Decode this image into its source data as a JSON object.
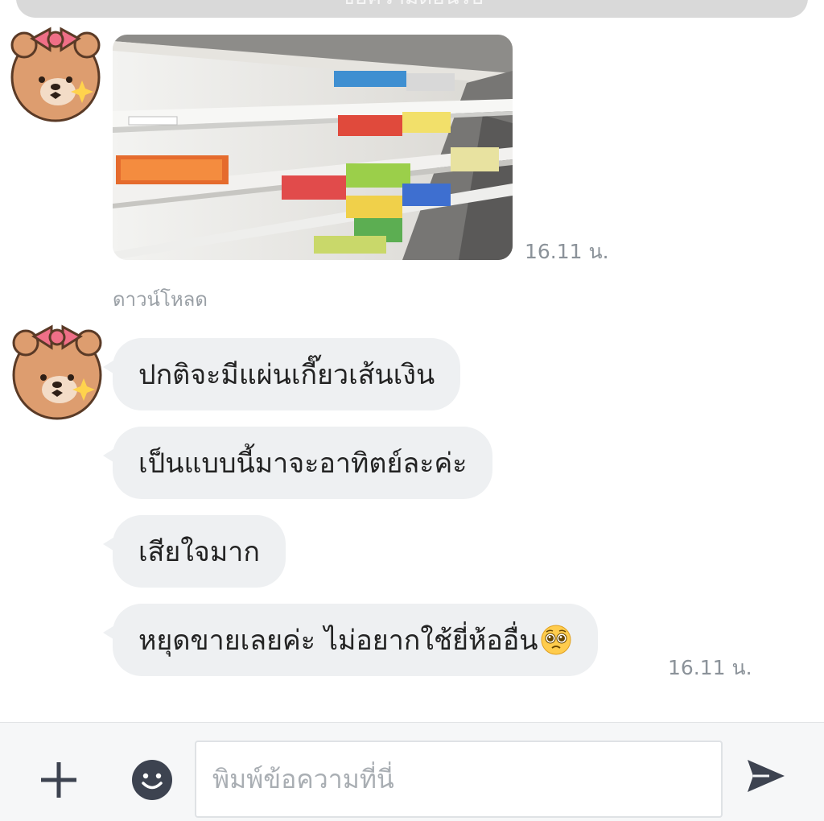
{
  "banner": {
    "text": "ข้อความต้อนรับ"
  },
  "messages": [
    {
      "type": "image",
      "time": "16.11 น.",
      "download_label": "ดาวน์โหลด"
    },
    {
      "type": "text",
      "text": "ปกติจะมีแผ่นเกี๊ยวเส้นเงิน"
    },
    {
      "type": "text",
      "text": "เป็นแบบนี้มาจะอาทิตย์ละค่ะ"
    },
    {
      "type": "text",
      "text": "เสียใจมาก"
    },
    {
      "type": "text",
      "text": "หยุดขายเลยค่ะ ไม่อยากใช้ยี่ห้ออื่น",
      "emoji": "pleading-face-emoji",
      "time": "16.11 น."
    }
  ],
  "composer": {
    "placeholder": "พิมพ์ข้อความที่นี่",
    "plus_icon": "plus-icon",
    "sticker_icon": "smiley-icon",
    "send_icon": "send-icon"
  },
  "colors": {
    "bubble_bg": "#eef0f2",
    "timestamp": "#8b9299",
    "icon": "#3d4350",
    "avatar_face": "#d99a6c",
    "bow": "#ee6f86"
  }
}
